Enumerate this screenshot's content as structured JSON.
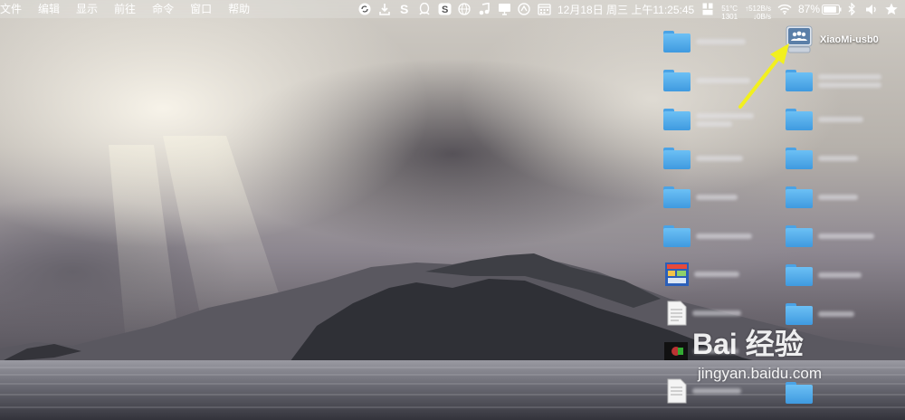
{
  "menubar": {
    "menus": [
      "文件",
      "编辑",
      "显示",
      "前往",
      "命令",
      "窗口",
      "帮助"
    ],
    "clock": "12月18日 周三 上午11:25:45",
    "cpu_temp": "51°C",
    "fan_rpm": "1301",
    "net_up": "↑512B/s",
    "net_down": "↓0B/s",
    "battery": "87%",
    "icons": [
      "sync-icon",
      "download-icon",
      "sogou-s-icon",
      "qq-icon",
      "sogou-input-icon",
      "globe-icon",
      "music-icon",
      "display-icon",
      "vpn-icon",
      "calendar-icon",
      "wifi-icon",
      "battery-icon",
      "bluetooth-icon",
      "volume-icon",
      "star-icon"
    ]
  },
  "desktop": {
    "drive_label": "XiaoMi-usb0",
    "drive_icon": "external-drive-icon",
    "accent": "#4aa3e6",
    "arrow_color": "#f2f01e"
  },
  "watermark": {
    "logo": "Bai 经验",
    "url": "jingyan.baidu.com"
  }
}
